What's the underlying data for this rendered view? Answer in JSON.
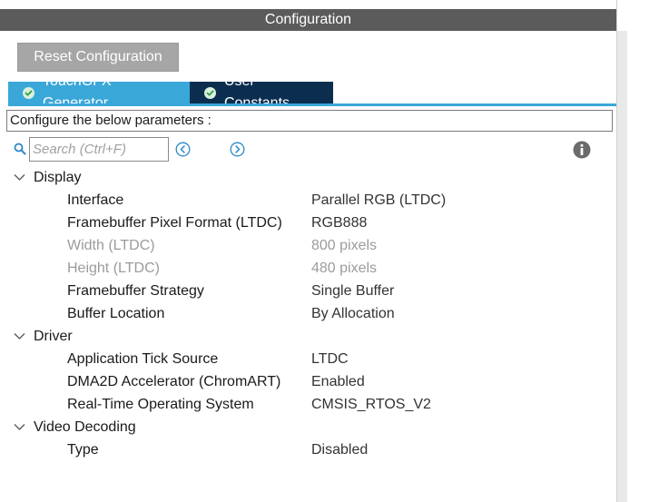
{
  "header": {
    "title": "Configuration"
  },
  "toolbar": {
    "reset_label": "Reset Configuration"
  },
  "tabs": [
    {
      "label": "TouchGFX Generator",
      "icon": "check-circle-icon",
      "active": true
    },
    {
      "label": "User Constants",
      "icon": "check-circle-icon",
      "active": false
    }
  ],
  "hint": "Configure the below parameters :",
  "search": {
    "placeholder": "Search (Ctrl+F)",
    "value": ""
  },
  "colors": {
    "tab_active": "#3aa7d9",
    "tab_inactive": "#0b2e4f",
    "title_bar": "#5b5b5b",
    "reset_button": "#a6a6a6"
  },
  "tree": {
    "display": {
      "label": "Display",
      "items": [
        {
          "name": "Interface",
          "value": "Parallel RGB (LTDC)"
        },
        {
          "name": "Framebuffer Pixel Format (LTDC)",
          "value": "RGB888"
        },
        {
          "name": "Width (LTDC)",
          "value": "800 pixels",
          "disabled": true
        },
        {
          "name": "Height (LTDC)",
          "value": "480 pixels",
          "disabled": true
        },
        {
          "name": "Framebuffer Strategy",
          "value": "Single Buffer"
        },
        {
          "name": "Buffer Location",
          "value": "By Allocation"
        }
      ]
    },
    "driver": {
      "label": "Driver",
      "items": [
        {
          "name": "Application Tick Source",
          "value": "LTDC"
        },
        {
          "name": "DMA2D Accelerator (ChromART)",
          "value": "Enabled"
        },
        {
          "name": "Real-Time Operating System",
          "value": "CMSIS_RTOS_V2"
        }
      ]
    },
    "video": {
      "label": "Video Decoding",
      "items": [
        {
          "name": "Type",
          "value": "Disabled"
        }
      ]
    }
  }
}
